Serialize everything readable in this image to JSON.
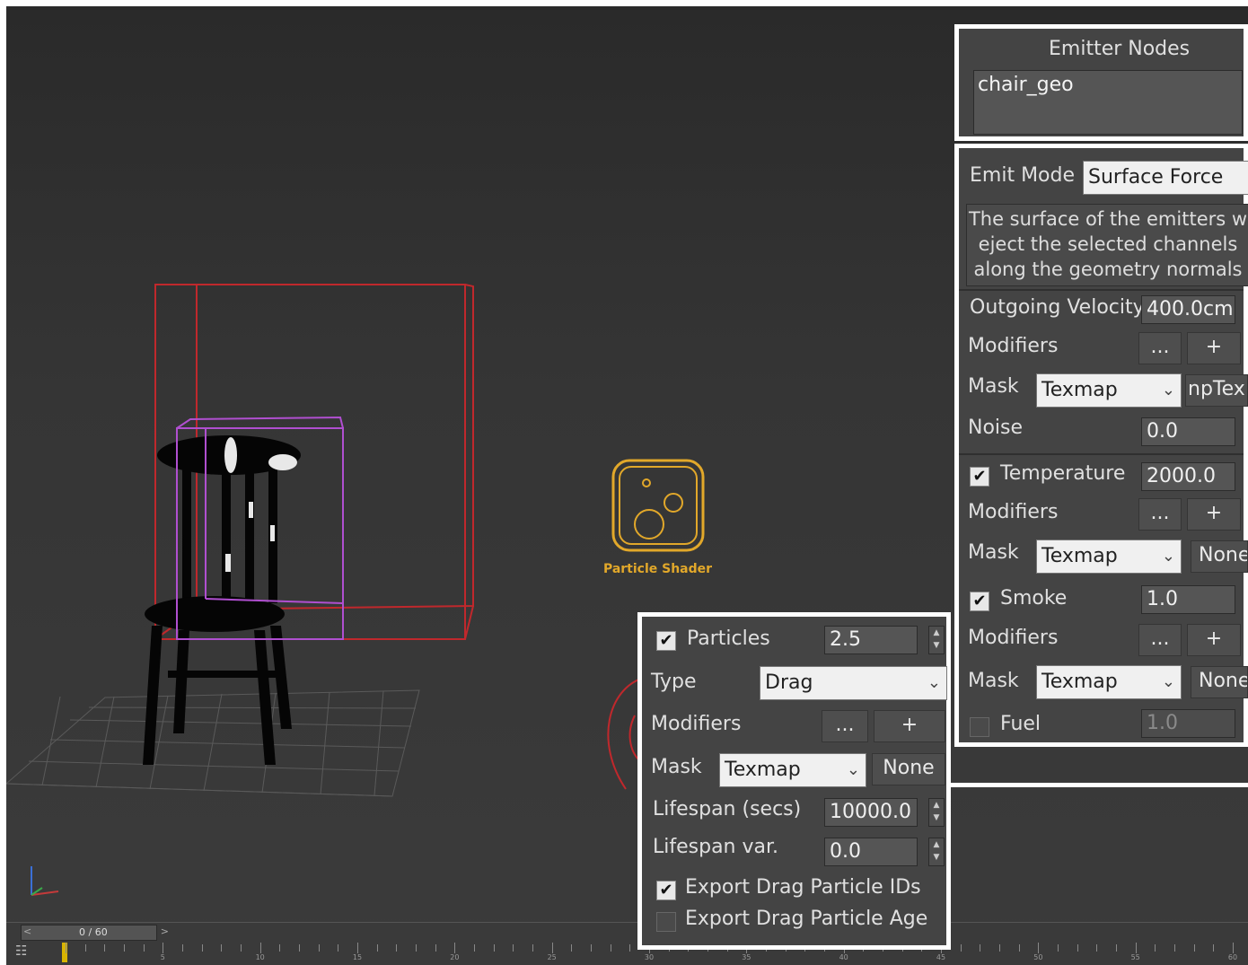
{
  "viewport": {
    "helper_label": "Particle Shader"
  },
  "timeline": {
    "frame_display": "0 / 60",
    "nav_left": "<",
    "nav_right": ">",
    "ruler_labels": [
      "5",
      "10",
      "15",
      "20",
      "25",
      "30",
      "35",
      "40",
      "45",
      "50",
      "55",
      "60"
    ]
  },
  "emitter_nodes": {
    "title": "Emitter Nodes",
    "items": [
      "chair_geo"
    ]
  },
  "emit_panel": {
    "emit_mode_label": "Emit Mode",
    "emit_mode_value": "Surface Force",
    "description_lines": [
      "The surface of the emitters w",
      "eject the selected channels",
      "along the geometry normals"
    ],
    "outgoing_velocity_label": "Outgoing Velocity",
    "outgoing_velocity_value": "400.0cm",
    "modifiers_label": "Modifiers",
    "modifiers_more": "...",
    "modifiers_add": "+",
    "mask_label": "Mask",
    "mask_type": "Texmap",
    "mask_map_1": "npTex",
    "noise_label": "Noise",
    "noise_value": "0.0",
    "temperature_label": "Temperature",
    "temperature_value": "2000.0",
    "temperature_checked": true,
    "mask_map_2": "None",
    "smoke_label": "Smoke",
    "smoke_value": "1.0",
    "smoke_checked": true,
    "mask_map_3": "None",
    "fuel_label": "Fuel",
    "fuel_value": "1.0",
    "fuel_checked": false
  },
  "particles_panel": {
    "particles_label": "Particles",
    "particles_value": "2.5",
    "particles_checked": true,
    "type_label": "Type",
    "type_value": "Drag",
    "modifiers_label": "Modifiers",
    "modifiers_more": "...",
    "modifiers_add": "+",
    "mask_label": "Mask",
    "mask_type": "Texmap",
    "mask_map": "None",
    "lifespan_label": "Lifespan (secs)",
    "lifespan_value": "10000.0",
    "lifespan_var_label": "Lifespan var.",
    "lifespan_var_value": "0.0",
    "export_ids_label": "Export Drag Particle IDs",
    "export_ids_checked": true,
    "export_age_label": "Export Drag Particle Age",
    "export_age_checked": false
  },
  "colors": {
    "bbox_red": "#c0282c",
    "bbox_purple": "#b04fd0",
    "helper_orange": "#e2a82a",
    "timeline_cursor": "#d9b500"
  }
}
